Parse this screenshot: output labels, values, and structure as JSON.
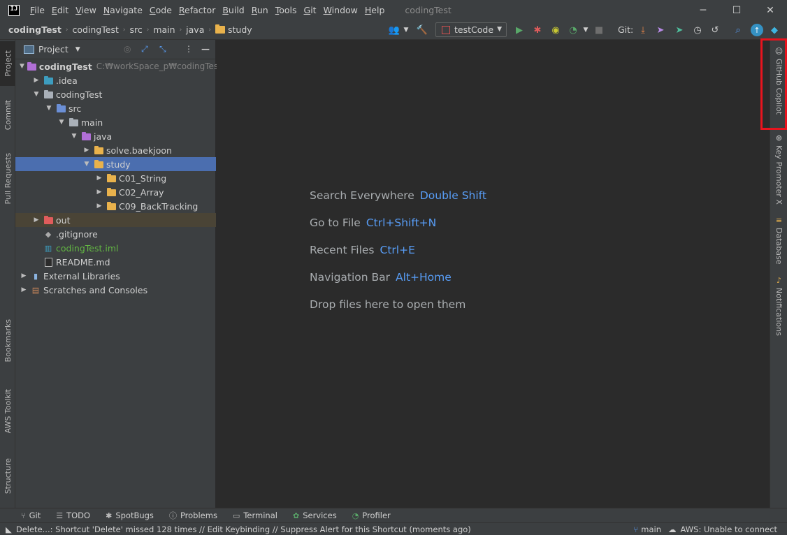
{
  "window": {
    "title": "codingTest",
    "logo_text": "IJ",
    "minimize": "─",
    "maximize": "☐",
    "close": "✕"
  },
  "menu": [
    {
      "label": "File",
      "mnemonic": "F",
      "rest": "ile"
    },
    {
      "label": "Edit",
      "mnemonic": "E",
      "rest": "dit"
    },
    {
      "label": "View",
      "mnemonic": "V",
      "rest": "iew"
    },
    {
      "label": "Navigate",
      "mnemonic": "N",
      "rest": "avigate"
    },
    {
      "label": "Code",
      "mnemonic": "C",
      "rest": "ode"
    },
    {
      "label": "Refactor",
      "mnemonic": "R",
      "rest": "efactor"
    },
    {
      "label": "Build",
      "mnemonic": "B",
      "rest": "uild"
    },
    {
      "label": "Run",
      "mnemonic": "R",
      "rest": "un"
    },
    {
      "label": "Tools",
      "mnemonic": "T",
      "rest": "ools"
    },
    {
      "label": "Git",
      "mnemonic": "G",
      "rest": "it"
    },
    {
      "label": "Window",
      "mnemonic": "W",
      "rest": "indow"
    },
    {
      "label": "Help",
      "mnemonic": "H",
      "rest": "elp"
    }
  ],
  "breadcrumbs": [
    "codingTest",
    "codingTest",
    "src",
    "main",
    "java",
    "study"
  ],
  "toolbar": {
    "run_config": "testCode",
    "git_label": "Git:"
  },
  "left_tabs": {
    "project": "Project",
    "commit": "Commit",
    "pull_requests": "Pull Requests",
    "bookmarks": "Bookmarks",
    "aws_toolkit": "AWS Toolkit",
    "structure": "Structure"
  },
  "project_panel": {
    "title": "Project",
    "tree": [
      {
        "label": "codingTest",
        "hint": "C:₩workSpace_p₩codingTest"
      },
      {
        "label": ".idea"
      },
      {
        "label": "codingTest"
      },
      {
        "label": "src"
      },
      {
        "label": "main"
      },
      {
        "label": "java"
      },
      {
        "label": "solve.baekjoon"
      },
      {
        "label": "study"
      },
      {
        "label": "C01_String"
      },
      {
        "label": "C02_Array"
      },
      {
        "label": "C09_BackTracking"
      },
      {
        "label": "out"
      },
      {
        "label": ".gitignore"
      },
      {
        "label": "codingTest.iml"
      },
      {
        "label": "README.md"
      },
      {
        "label": "External Libraries"
      },
      {
        "label": "Scratches and Consoles"
      }
    ]
  },
  "editor_hints": [
    {
      "text": "Search Everywhere",
      "key": "Double Shift"
    },
    {
      "text": "Go to File",
      "key": "Ctrl+Shift+N"
    },
    {
      "text": "Recent Files",
      "key": "Ctrl+E"
    },
    {
      "text": "Navigation Bar",
      "key": "Alt+Home"
    },
    {
      "text": "Drop files here to open them",
      "key": ""
    }
  ],
  "right_tabs": {
    "copilot": "GitHub Copilot",
    "key_promoter": "Key Promoter X",
    "database": "Database",
    "notifications": "Notifications"
  },
  "bottom_tools": [
    "Git",
    "TODO",
    "SpotBugs",
    "Problems",
    "Terminal",
    "Services",
    "Profiler"
  ],
  "status": {
    "message": "Delete...: Shortcut 'Delete' missed 128 times // Edit Keybinding // Suppress Alert for this Shortcut (moments ago)",
    "branch": "main",
    "aws": "AWS: Unable to connect"
  },
  "colors": {
    "accent_blue": "#589df6",
    "selection": "#4b6eaf",
    "highlight_red": "#e8141e"
  }
}
